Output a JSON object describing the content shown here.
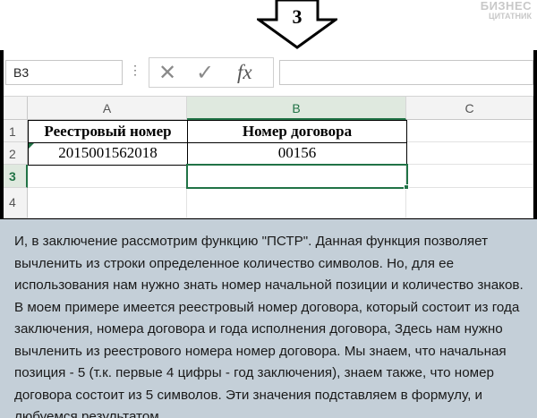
{
  "step_number": "3",
  "logo": {
    "line1": "БИЗНЕС",
    "line2": "ЦИТАТНИК"
  },
  "formula_bar": {
    "name_box": "B3",
    "dots": "⋮",
    "cancel_icon": "close-icon",
    "confirm_icon": "check-icon",
    "fx_label": "fx",
    "formula": ""
  },
  "sheet": {
    "columns": [
      "A",
      "B",
      "C"
    ],
    "rows": [
      "1",
      "2",
      "3",
      "4"
    ],
    "selected_column": "B",
    "selected_row": "3",
    "cells": {
      "A1": "Реестровый номер",
      "B1": "Номер договора",
      "A2": "2015001562018",
      "B2": "00156",
      "B3": ""
    },
    "accent_color": "#217346"
  },
  "description": "И, в заключение рассмотрим функцию \"ПСТР\". Данная функция позволяет вычленить из строки определенное количество символов. Но, для ее использования нам нужно знать номер начальной позиции и количество знаков. В моем примере имеется реестровый номер договора, который состоит из года заключения, номера договора и года исполнения договора, Здесь нам нужно вычленить из реестрового номера номер договора. Мы знаем, что начальная позиция - 5 (т.к. первые 4 цифры - год заключения), знаем также, что номер договора состоит из 5 символов. Эти значения подставляем в формулу, и любуемся результатом."
}
